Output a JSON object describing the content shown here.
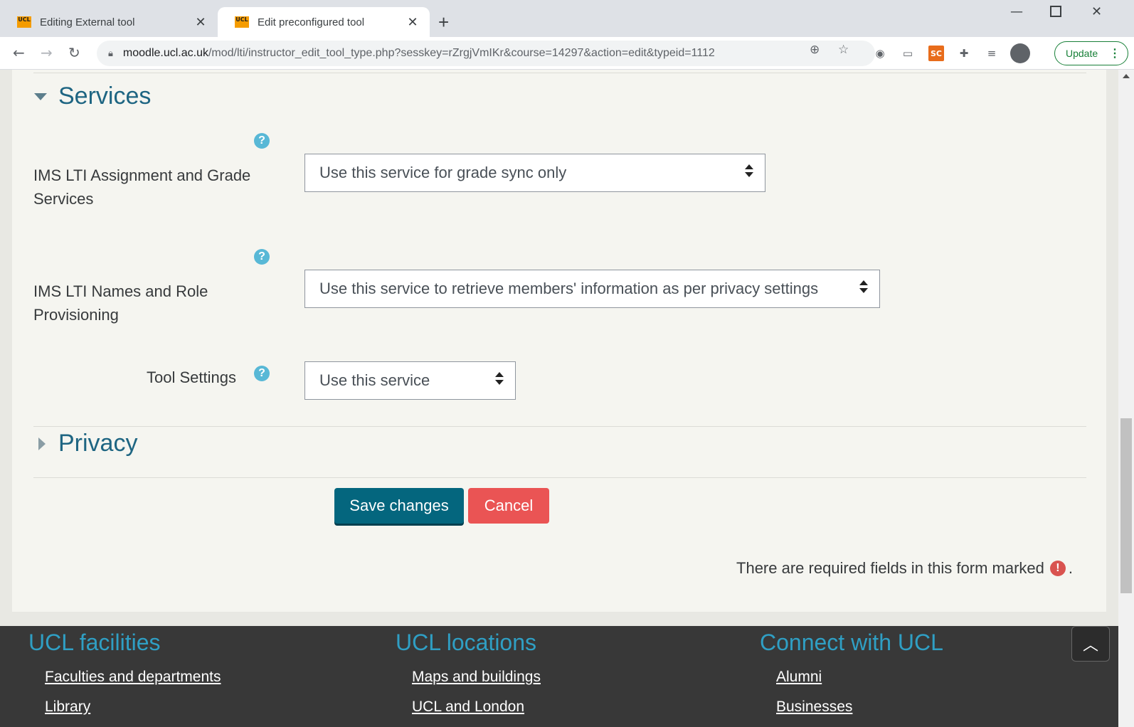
{
  "browser": {
    "tabs": [
      {
        "title": "Editing External tool",
        "favicon": "UCL"
      },
      {
        "title": "Edit preconfigured tool",
        "favicon": "UCL"
      }
    ],
    "address": {
      "host": "moodle.ucl.ac.uk",
      "path": "/mod/lti/instructor_edit_tool_type.php?sesskey=rZrgjVmIKr&course=14297&action=edit&typeid=1112"
    },
    "extensions": {
      "sc_label": "SC"
    },
    "update_label": "Update"
  },
  "form": {
    "services": {
      "title": "Services",
      "fields": [
        {
          "label": "IMS LTI Assignment and Grade Services",
          "value": "Use this service for grade sync only"
        },
        {
          "label": "IMS LTI Names and Role Provisioning",
          "value": "Use this service to retrieve members' information as per privacy settings"
        },
        {
          "label": "Tool Settings",
          "value": "Use this service"
        }
      ]
    },
    "privacy": {
      "title": "Privacy"
    },
    "save_label": "Save changes",
    "cancel_label": "Cancel",
    "required_note": "There are required fields in this form marked",
    "required_note_end": "."
  },
  "footer": {
    "columns": [
      {
        "heading": "UCL facilities",
        "links": [
          "Faculties and departments",
          "Library"
        ]
      },
      {
        "heading": "UCL locations",
        "links": [
          "Maps and buildings",
          "UCL and London"
        ]
      },
      {
        "heading": "Connect with UCL",
        "links": [
          "Alumni",
          "Businesses"
        ]
      }
    ]
  },
  "colors": {
    "accent": "#1e6582",
    "save": "#04667e",
    "cancel": "#ea5454",
    "footer_bg": "#383838",
    "footer_heading": "#2f9fc4"
  }
}
